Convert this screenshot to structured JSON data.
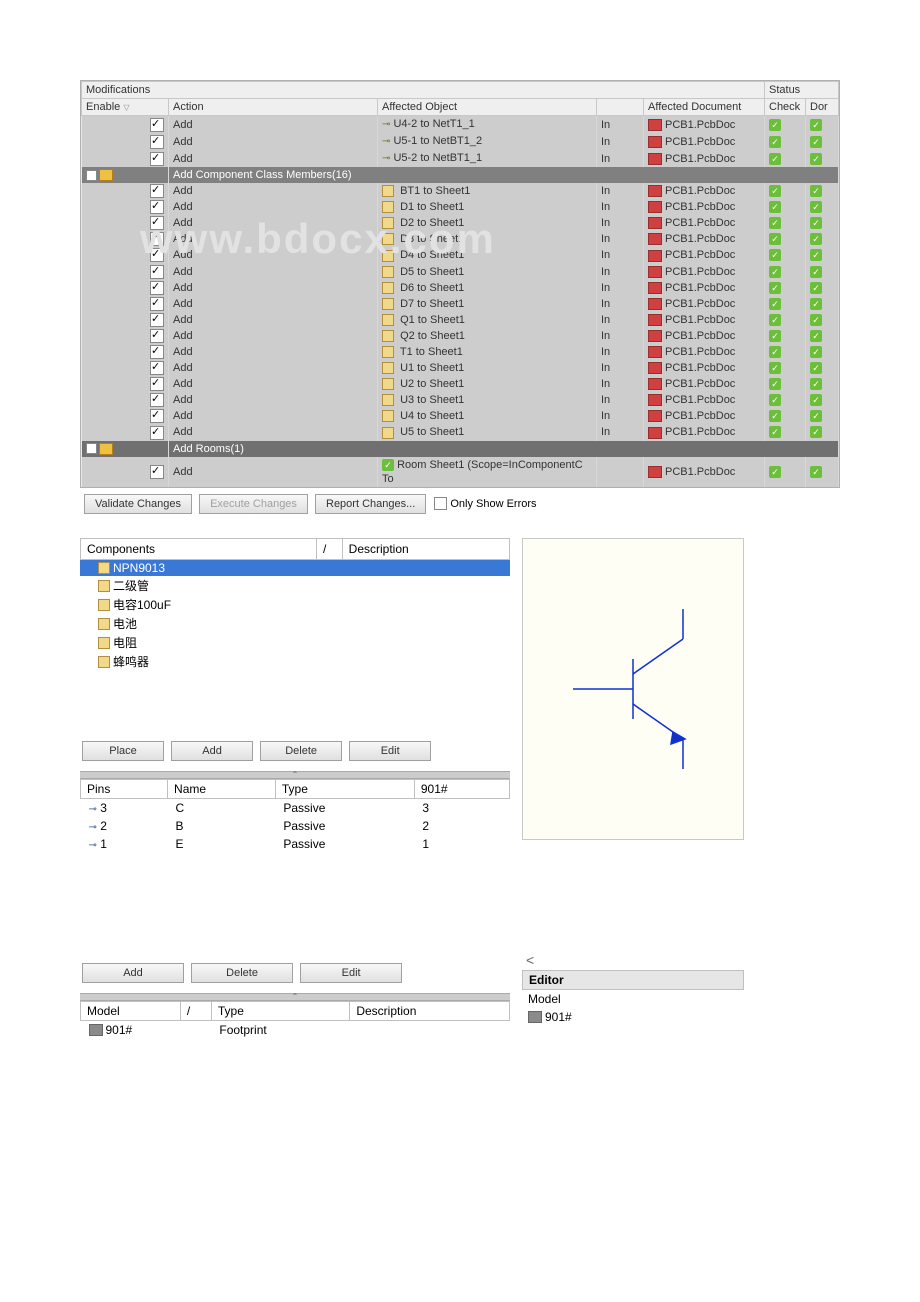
{
  "mod": {
    "title": "Modifications",
    "status_title": "Status",
    "cols": [
      "Enable",
      "Action",
      "Affected Object",
      "",
      "Affected Document",
      "Check",
      "Dor"
    ],
    "pre_rows": [
      {
        "action": "Add",
        "obj": "U4-2 to NetT1_1",
        "to": "In",
        "doc": "PCB1.PcbDoc"
      },
      {
        "action": "Add",
        "obj": "U5-1 to NetBT1_2",
        "to": "In",
        "doc": "PCB1.PcbDoc"
      },
      {
        "action": "Add",
        "obj": "U5-2 to NetBT1_1",
        "to": "In",
        "doc": "PCB1.PcbDoc"
      }
    ],
    "group1": "Add Component Class Members(16)",
    "rows": [
      {
        "action": "Add",
        "obj": "BT1 to Sheet1",
        "to": "In",
        "doc": "PCB1.PcbDoc"
      },
      {
        "action": "Add",
        "obj": "D1 to Sheet1",
        "to": "In",
        "doc": "PCB1.PcbDoc"
      },
      {
        "action": "Add",
        "obj": "D2 to Sheet1",
        "to": "In",
        "doc": "PCB1.PcbDoc"
      },
      {
        "action": "Add",
        "obj": "D3 to Sheet1",
        "to": "In",
        "doc": "PCB1.PcbDoc"
      },
      {
        "action": "Add",
        "obj": "D4 to Sheet1",
        "to": "In",
        "doc": "PCB1.PcbDoc"
      },
      {
        "action": "Add",
        "obj": "D5 to Sheet1",
        "to": "In",
        "doc": "PCB1.PcbDoc"
      },
      {
        "action": "Add",
        "obj": "D6 to Sheet1",
        "to": "In",
        "doc": "PCB1.PcbDoc"
      },
      {
        "action": "Add",
        "obj": "D7 to Sheet1",
        "to": "In",
        "doc": "PCB1.PcbDoc"
      },
      {
        "action": "Add",
        "obj": "Q1 to Sheet1",
        "to": "In",
        "doc": "PCB1.PcbDoc"
      },
      {
        "action": "Add",
        "obj": "Q2 to Sheet1",
        "to": "In",
        "doc": "PCB1.PcbDoc"
      },
      {
        "action": "Add",
        "obj": "T1 to Sheet1",
        "to": "In",
        "doc": "PCB1.PcbDoc"
      },
      {
        "action": "Add",
        "obj": "U1 to Sheet1",
        "to": "In",
        "doc": "PCB1.PcbDoc"
      },
      {
        "action": "Add",
        "obj": "U2 to Sheet1",
        "to": "In",
        "doc": "PCB1.PcbDoc"
      },
      {
        "action": "Add",
        "obj": "U3 to Sheet1",
        "to": "In",
        "doc": "PCB1.PcbDoc"
      },
      {
        "action": "Add",
        "obj": "U4 to Sheet1",
        "to": "In",
        "doc": "PCB1.PcbDoc"
      },
      {
        "action": "Add",
        "obj": "U5 to Sheet1",
        "to": "In",
        "doc": "PCB1.PcbDoc"
      }
    ],
    "group2": "Add Rooms(1)",
    "room_row": {
      "action": "Add",
      "obj": "Room Sheet1 (Scope=InComponentC To",
      "doc": "PCB1.PcbDoc"
    },
    "btns": {
      "validate": "Validate Changes",
      "execute": "Execute Changes",
      "report": "Report Changes...",
      "only": "Only Show Errors"
    }
  },
  "lib": {
    "cols": [
      "Components",
      "/",
      "Description"
    ],
    "items": [
      "NPN9013",
      "二级管",
      "电容100uF",
      "电池",
      "电阻",
      "蜂鸣器"
    ],
    "btns": {
      "place": "Place",
      "add": "Add",
      "delete": "Delete",
      "edit": "Edit"
    },
    "pins_cols": [
      "Pins",
      "Name",
      "Type",
      "901#"
    ],
    "pins": [
      {
        "n": "3",
        "name": "C",
        "type": "Passive",
        "p": "3"
      },
      {
        "n": "2",
        "name": "B",
        "type": "Passive",
        "p": "2"
      },
      {
        "n": "1",
        "name": "E",
        "type": "Passive",
        "p": "1"
      }
    ],
    "btns2": {
      "add": "Add",
      "delete": "Delete",
      "edit": "Edit"
    },
    "model_cols": [
      "Model",
      "/",
      "Type",
      "Description"
    ],
    "model_row": {
      "name": "901#",
      "type": "Footprint"
    }
  },
  "editor": {
    "title": "Editor",
    "model_label": "Model",
    "model_val": "901#"
  },
  "watermark": "www.bdocx.com"
}
